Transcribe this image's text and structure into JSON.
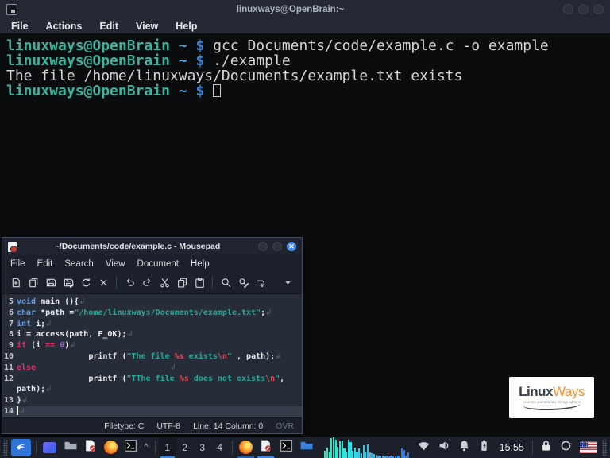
{
  "terminal": {
    "window_title": "linuxways@OpenBrain:~",
    "menu": [
      "File",
      "Actions",
      "Edit",
      "View",
      "Help"
    ],
    "lines": [
      {
        "type": "prompt",
        "user": "linuxways@OpenBrain",
        "path": "~",
        "symbol": "$",
        "command": "gcc Documents/code/example.c -o example"
      },
      {
        "type": "prompt",
        "user": "linuxways@OpenBrain",
        "path": "~",
        "symbol": "$",
        "command": "./example"
      },
      {
        "type": "output",
        "text": "The file /home/linuxways/Documents/example.txt exists"
      },
      {
        "type": "prompt",
        "user": "linuxways@OpenBrain",
        "path": "~",
        "symbol": "$",
        "command": "",
        "cursor": true
      }
    ]
  },
  "editor": {
    "window_title": "~/Documents/code/example.c - Mousepad",
    "menu": [
      "File",
      "Edit",
      "Search",
      "View",
      "Document",
      "Help"
    ],
    "toolbar_groups": [
      [
        "new-document",
        "open-document",
        "save",
        "save-as",
        "reload",
        "close-file"
      ],
      [
        "undo",
        "redo",
        "cut",
        "copy",
        "paste"
      ],
      [
        "find",
        "find-replace",
        "go-to"
      ],
      [
        "toolbar-more"
      ]
    ],
    "code": [
      {
        "num": "5",
        "tokens": [
          [
            "kw",
            "void"
          ],
          [
            "pl",
            " main (){"
          ],
          [
            "nl",
            "↲"
          ]
        ]
      },
      {
        "num": "6",
        "tokens": [
          [
            "kw",
            "char"
          ],
          [
            "pl",
            " *path ="
          ],
          [
            "str",
            "\"/home/linuxways/Documents/example.txt\""
          ],
          [
            "pl",
            ";"
          ],
          [
            "nl",
            "↲"
          ]
        ]
      },
      {
        "num": "7",
        "tokens": [
          [
            "kw",
            "int"
          ],
          [
            "pl",
            " i;"
          ],
          [
            "nl",
            "↲"
          ]
        ]
      },
      {
        "num": "8",
        "tokens": [
          [
            "pl",
            "i = access(path, F_OK);"
          ],
          [
            "nl",
            "↲"
          ]
        ]
      },
      {
        "num": "9",
        "tokens": [
          [
            "ctrl",
            "if"
          ],
          [
            "pl",
            " (i "
          ],
          [
            "ctrl",
            "=="
          ],
          [
            "pl",
            " "
          ],
          [
            "num",
            "0"
          ],
          [
            "pl",
            ")"
          ],
          [
            "nl",
            "↲"
          ]
        ]
      },
      {
        "num": "10",
        "tokens": [
          [
            "pl",
            "               printf ("
          ],
          [
            "str",
            "\"The file "
          ],
          [
            "esc",
            "%s"
          ],
          [
            "str",
            " exists"
          ],
          [
            "esc",
            "\\n"
          ],
          [
            "str",
            "\""
          ],
          [
            "pl",
            " , path);"
          ],
          [
            "nl",
            "↲"
          ]
        ]
      },
      {
        "num": "11",
        "tokens": [
          [
            "ctrl",
            "else"
          ],
          [
            "pl",
            "                            "
          ],
          [
            "nl",
            "↲"
          ]
        ]
      },
      {
        "num": "12",
        "tokens": [
          [
            "pl",
            "               printf ("
          ],
          [
            "str",
            "\"TThe file "
          ],
          [
            "esc",
            "%s"
          ],
          [
            "str",
            " does not exists"
          ],
          [
            "esc",
            "\\n"
          ],
          [
            "str",
            "\""
          ],
          [
            "pl",
            ", path);"
          ],
          [
            "nl",
            "↲"
          ]
        ]
      },
      {
        "num": "13",
        "tokens": [
          [
            "pl",
            "}"
          ],
          [
            "nl",
            "↲"
          ]
        ]
      },
      {
        "num": "14",
        "current": true,
        "tokens": [
          [
            "cur",
            ""
          ],
          [
            "nl",
            "↲"
          ]
        ]
      }
    ],
    "statusbar": {
      "filetype": "Filetype: C",
      "encoding": "UTF-8",
      "position": "Line: 14 Column: 0",
      "overwrite": "OVR"
    }
  },
  "taskbar": {
    "workspaces": [
      {
        "label": "1",
        "active": true
      },
      {
        "label": "2",
        "active": false
      },
      {
        "label": "3",
        "active": false
      },
      {
        "label": "4",
        "active": false
      }
    ],
    "caret_label": "^",
    "clock": "15:55",
    "visualizer_bars": [
      0.35,
      0.5,
      0.3,
      0.95,
      1,
      0.9,
      0.55,
      0.8,
      0.85,
      0.45,
      0.3,
      0.9,
      0.75,
      0.35,
      0.5,
      0.3,
      0.45,
      0.22,
      0.6,
      0.3,
      0.65,
      0.28,
      0.22,
      0.18,
      0.14,
      0.12,
      0.1,
      0.12,
      0.09,
      0.11,
      0.08,
      0.1,
      0.07,
      0.09,
      0.11,
      0.08,
      0.45,
      0.4,
      0.12,
      0.28
    ]
  },
  "logo": {
    "word1": "Linux",
    "word2": "Ways",
    "tagline": "How-tos and tutorials for sys admins"
  },
  "colors": {
    "accent_blue": "#3f86e0",
    "prompt_teal": "#3cb39c",
    "keyword_blue": "#5b9bf0",
    "control_pink": "#d0396a",
    "string_teal": "#2fa597",
    "escape_red": "#e04b57"
  }
}
